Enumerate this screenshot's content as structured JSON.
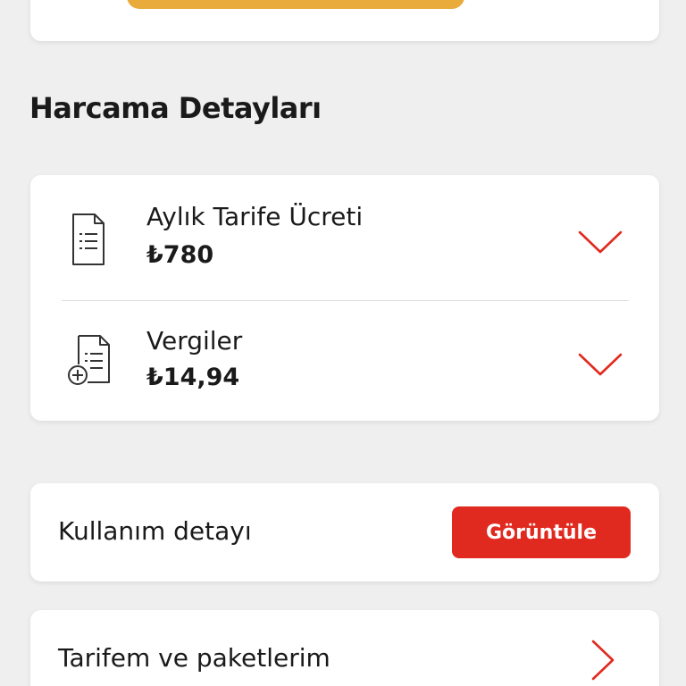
{
  "section": {
    "title": "Harcama Detayları"
  },
  "details": [
    {
      "label": "Aylık Tarife Ücreti",
      "amount": "₺780",
      "icon": "document-list-icon"
    },
    {
      "label": "Vergiler",
      "amount": "₺14,94",
      "icon": "document-tax-icon"
    }
  ],
  "usage": {
    "label": "Kullanım detayı",
    "button_label": "Görüntüle"
  },
  "tariff": {
    "label": "Tarifem ve paketlerim"
  },
  "colors": {
    "accent_red": "#e12a1f",
    "top_pill": "#e9ab3b",
    "background": "#efefef",
    "card": "#ffffff"
  }
}
